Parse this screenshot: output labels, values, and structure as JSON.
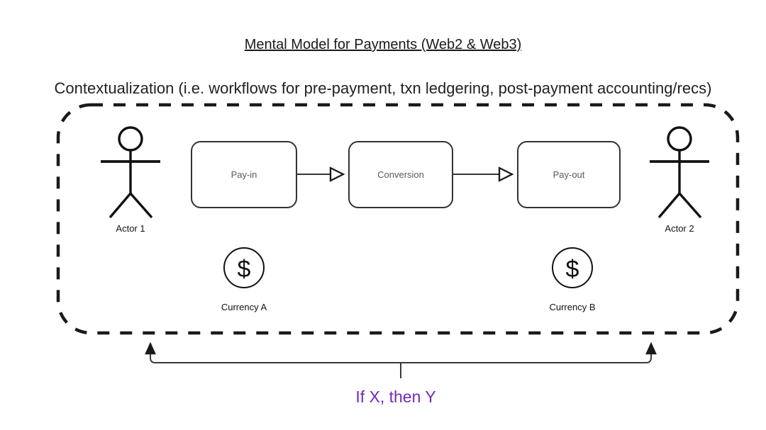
{
  "page": {
    "title": "Mental Model for Payments (Web2 & Web3)",
    "subtitle": "Contextualization (i.e. workflows for pre-payment, txn ledgering, post-payment accounting/recs)",
    "background_color": "#ffffff"
  },
  "container": {
    "name": "contextualization-boundary",
    "style": "dashed-rounded-rectangle",
    "stroke_color": "#1a1a1a"
  },
  "actors": [
    {
      "label": "Actor 1",
      "icon": "stick-figure-icon"
    },
    {
      "label": "Actor 2",
      "icon": "stick-figure-icon"
    }
  ],
  "process_boxes": [
    {
      "label": "Pay-in"
    },
    {
      "label": "Conversion"
    },
    {
      "label": "Pay-out"
    }
  ],
  "arrows": [
    {
      "from": "Pay-in",
      "to": "Conversion",
      "head": "open-triangle"
    },
    {
      "from": "Conversion",
      "to": "Pay-out",
      "head": "open-triangle"
    }
  ],
  "currencies": [
    {
      "label": "Currency A",
      "symbol": "$",
      "icon": "dollar-coin-icon"
    },
    {
      "label": "Currency B",
      "symbol": "$",
      "icon": "dollar-coin-icon"
    }
  ],
  "annotation": {
    "label": "If X, then Y",
    "color": "#7129ba",
    "connector": "bracket-with-up-arrows"
  },
  "colors": {
    "line": "#1a1a1a",
    "box_stroke": "#333333",
    "box_label": "#5a5a5a",
    "accent_purple": "#7129ba"
  }
}
